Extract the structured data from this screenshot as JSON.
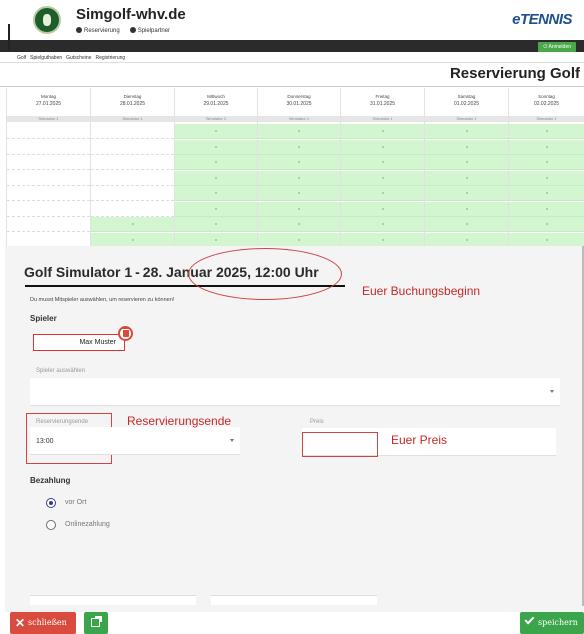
{
  "header": {
    "site_title": "Simgolf-whv.de",
    "nav_reservierung": "Reservierung",
    "nav_spielpartner": "Spielpartner",
    "brand": "eTENNIS",
    "login": "Anmelden"
  },
  "subnav": [
    "Golf",
    "Spielguthaben",
    "Gutscheine",
    "Registrierung"
  ],
  "page_heading": "Reservierung Golf",
  "calendar": {
    "simulator_label": "Simulator 1",
    "days": [
      {
        "day": "Montag",
        "date": "27.01.2025"
      },
      {
        "day": "Dienstag",
        "date": "28.01.2025"
      },
      {
        "day": "Mittwoch",
        "date": "29.01.2025"
      },
      {
        "day": "Donnerstag",
        "date": "30.01.2025"
      },
      {
        "day": "Freitag",
        "date": "31.01.2025"
      },
      {
        "day": "Samstag",
        "date": "01.02.2025"
      },
      {
        "day": "Sonntag",
        "date": "02.02.2025"
      }
    ]
  },
  "booking": {
    "title_prefix": "Golf Simulator 1",
    "title_date": "28. Januar 2025, 12:00 Uhr",
    "hint": "Du musst Mitspieler auswählen, um reservieren zu können!",
    "spieler_label": "Spieler",
    "player_name": "Max Muster",
    "select_player_label": "Spieler auswählen",
    "end_label": "Reservierungsende",
    "end_value": "13:00",
    "price_label": "Preis",
    "payment_label": "Bezahlung",
    "payment_options": [
      "vor Ort",
      "Onlinezahlung"
    ],
    "payment_selected": "vor Ort"
  },
  "annotations": {
    "start": "Euer Buchungsbeginn",
    "end": "Reservierungsende",
    "price": "Euer Preis"
  },
  "footer": {
    "close_label": "schließen",
    "save_label": "speichern"
  },
  "colors": {
    "free_slot": "#d3f5cf",
    "primary_green": "#3aa54a",
    "danger_red": "#d94b3e",
    "annotation_red": "#c62828"
  }
}
